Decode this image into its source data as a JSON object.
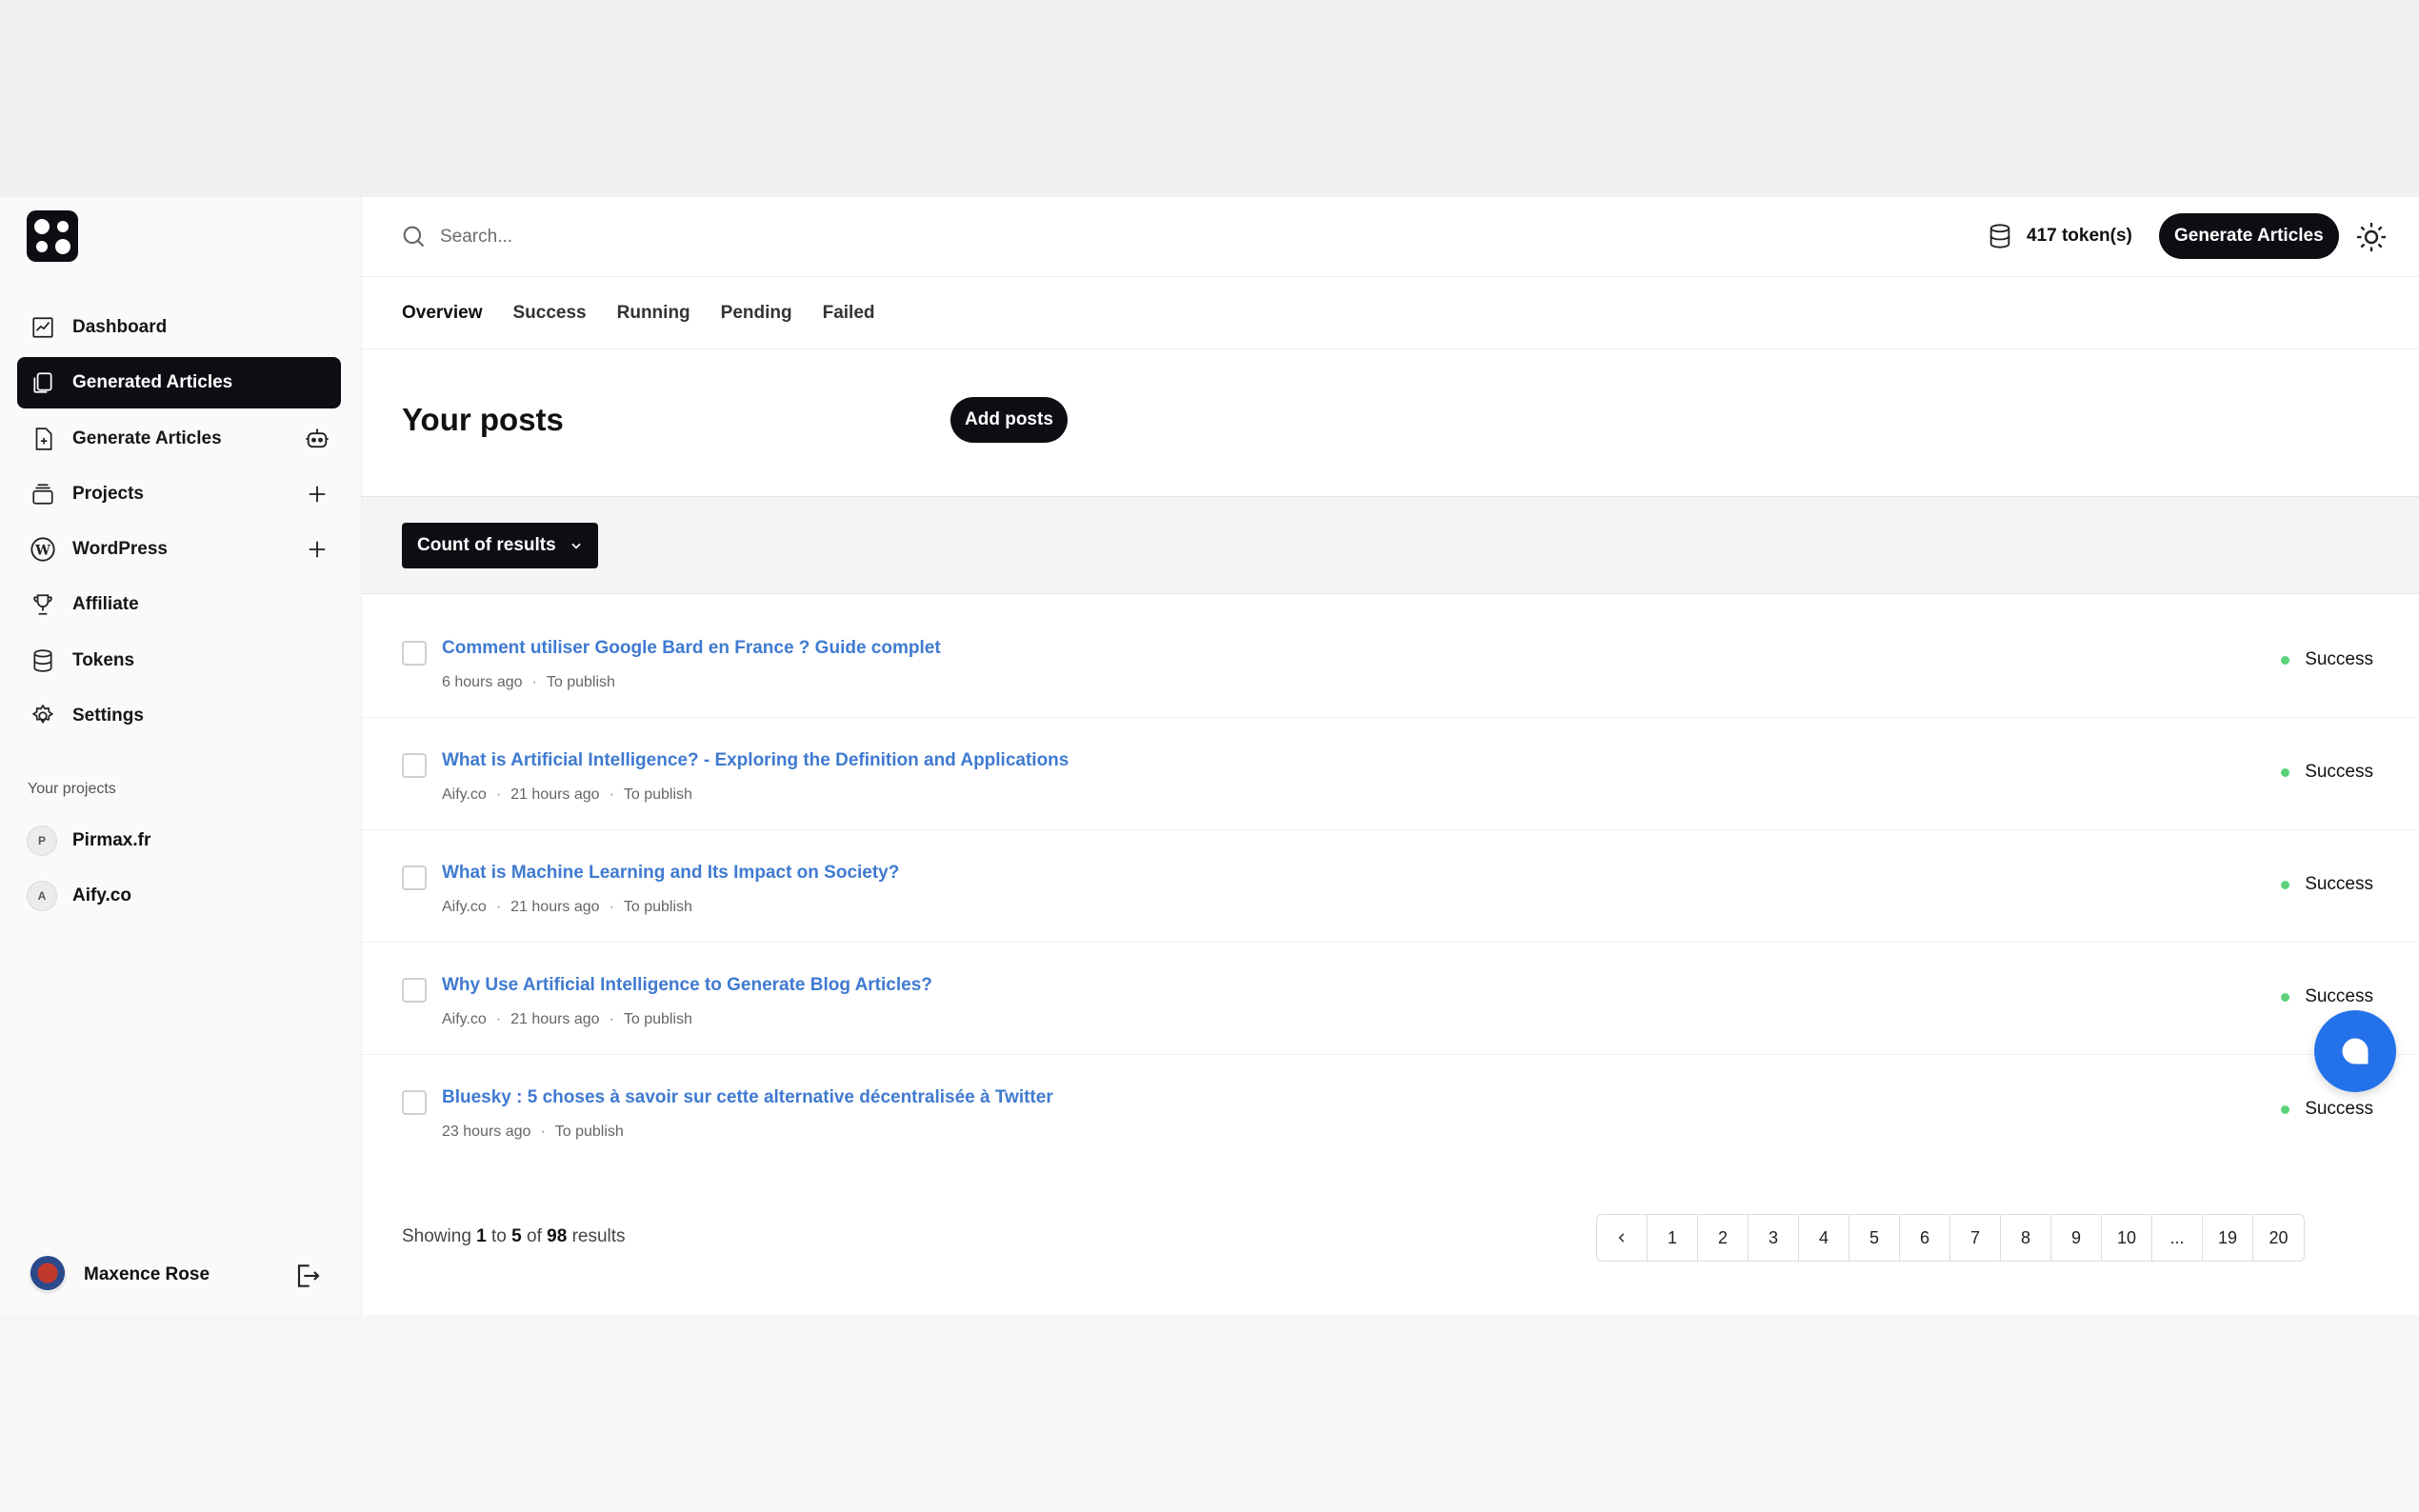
{
  "search": {
    "placeholder": "Search..."
  },
  "header": {
    "tokens": "417 token(s)",
    "generate_label": "Generate Articles"
  },
  "sidebar": {
    "items": [
      {
        "label": "Dashboard"
      },
      {
        "label": "Generated Articles"
      },
      {
        "label": "Generate Articles"
      },
      {
        "label": "Projects"
      },
      {
        "label": "WordPress"
      },
      {
        "label": "Affiliate"
      },
      {
        "label": "Tokens"
      },
      {
        "label": "Settings"
      }
    ],
    "projects_label": "Your projects",
    "projects": [
      {
        "initial": "P",
        "name": "Pirmax.fr"
      },
      {
        "initial": "A",
        "name": "Aify.co"
      }
    ],
    "user": {
      "name": "Maxence Rose"
    }
  },
  "tabs": [
    "Overview",
    "Success",
    "Running",
    "Pending",
    "Failed"
  ],
  "main": {
    "title": "Your posts",
    "add_label": "Add posts",
    "filter_label": "Count of results"
  },
  "posts": [
    {
      "title": "Comment utiliser Google Bard en France ? Guide complet",
      "site": "",
      "time": "6 hours ago",
      "state": "To publish",
      "status": "Success"
    },
    {
      "title": "What is Artificial Intelligence? - Exploring the Definition and Applications",
      "site": "Aify.co",
      "time": "21 hours ago",
      "state": "To publish",
      "status": "Success"
    },
    {
      "title": "What is Machine Learning and Its Impact on Society?",
      "site": "Aify.co",
      "time": "21 hours ago",
      "state": "To publish",
      "status": "Success"
    },
    {
      "title": "Why Use Artificial Intelligence to Generate Blog Articles?",
      "site": "Aify.co",
      "time": "21 hours ago",
      "state": "To publish",
      "status": "Success"
    },
    {
      "title": "Bluesky : 5 choses à savoir sur cette alternative décentralisée à Twitter",
      "site": "",
      "time": "23 hours ago",
      "state": "To publish",
      "status": "Success"
    }
  ],
  "pagination": {
    "showing": "Showing",
    "from": "1",
    "to_word": "to",
    "to": "5",
    "of_word": "of",
    "total": "98",
    "results_word": "results",
    "pages": [
      "1",
      "2",
      "3",
      "4",
      "5",
      "6",
      "7",
      "8",
      "9",
      "10",
      "...",
      "19",
      "20"
    ]
  },
  "colors": {
    "accent": "#0d0d14",
    "link": "#3f7ad0",
    "success": "#5bd27a",
    "chat": "#2472e9"
  }
}
